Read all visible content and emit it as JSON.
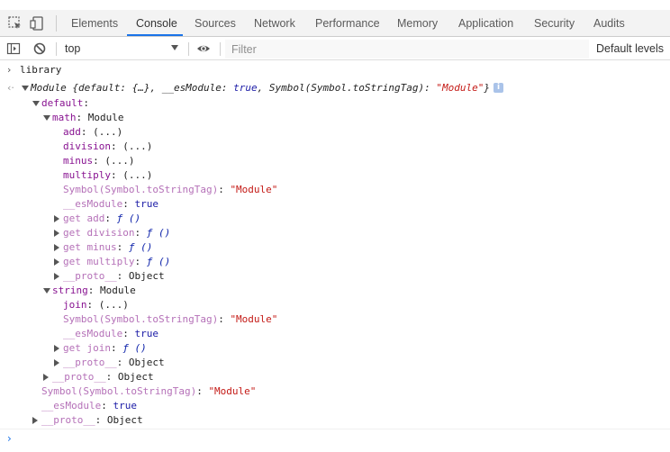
{
  "tabs": [
    {
      "label": "Elements",
      "active": false
    },
    {
      "label": "Console",
      "active": true
    },
    {
      "label": "Sources",
      "active": false
    },
    {
      "label": "Network",
      "active": false
    },
    {
      "label": "Performance",
      "active": false
    },
    {
      "label": "Memory",
      "active": false
    },
    {
      "label": "Application",
      "active": false
    },
    {
      "label": "Security",
      "active": false
    },
    {
      "label": "Audits",
      "active": false
    }
  ],
  "tab_icons": [
    "inspect-element-icon",
    "device-toolbar-icon"
  ],
  "toolbar": {
    "sidebar_icon": "sidebar-toggle-icon",
    "clear_icon": "clear-console-icon",
    "context": "top",
    "eye_icon": "eye-icon",
    "filter_placeholder": "Filter",
    "filter_value": "",
    "levels": "Default levels"
  },
  "accent_color": "#1a73e8",
  "console": {
    "input": "library",
    "result": {
      "head": "Module {default: {…}, __esModule: ",
      "esmodule_value": "true",
      "tag_text": ", Symbol(Symbol.toStringTag): ",
      "tag_value": "\"Module\"",
      "tail": "}",
      "info": "i"
    },
    "lines": [
      {
        "indent": 0,
        "expander": "down",
        "key": "default",
        "dim": false,
        "parts": []
      },
      {
        "indent": 1,
        "expander": "down",
        "key": "math",
        "dim": false,
        "parts": [
          {
            "text": "Module",
            "cls": ""
          }
        ]
      },
      {
        "indent": 2,
        "expander": "none",
        "key": "add",
        "dim": false,
        "parts": [
          {
            "text": "(...)",
            "cls": ""
          }
        ]
      },
      {
        "indent": 2,
        "expander": "none",
        "key": "division",
        "dim": false,
        "parts": [
          {
            "text": "(...)",
            "cls": ""
          }
        ]
      },
      {
        "indent": 2,
        "expander": "none",
        "key": "minus",
        "dim": false,
        "parts": [
          {
            "text": "(...)",
            "cls": ""
          }
        ]
      },
      {
        "indent": 2,
        "expander": "none",
        "key": "multiply",
        "dim": false,
        "parts": [
          {
            "text": "(...)",
            "cls": ""
          }
        ]
      },
      {
        "indent": 2,
        "expander": "none",
        "key": "Symbol(Symbol.toStringTag)",
        "dim": true,
        "parts": [
          {
            "text": "\"Module\"",
            "cls": "s"
          }
        ]
      },
      {
        "indent": 2,
        "expander": "none",
        "key": "__esModule",
        "dim": true,
        "parts": [
          {
            "text": "true",
            "cls": "bool"
          }
        ]
      },
      {
        "indent": 2,
        "expander": "right",
        "key": "get add",
        "dim": true,
        "parts": [
          {
            "text": "ƒ ()",
            "cls": "fn"
          }
        ]
      },
      {
        "indent": 2,
        "expander": "right",
        "key": "get division",
        "dim": true,
        "parts": [
          {
            "text": "ƒ ()",
            "cls": "fn"
          }
        ]
      },
      {
        "indent": 2,
        "expander": "right",
        "key": "get minus",
        "dim": true,
        "parts": [
          {
            "text": "ƒ ()",
            "cls": "fn"
          }
        ]
      },
      {
        "indent": 2,
        "expander": "right",
        "key": "get multiply",
        "dim": true,
        "parts": [
          {
            "text": "ƒ ()",
            "cls": "fn"
          }
        ]
      },
      {
        "indent": 2,
        "expander": "right",
        "key": "__proto__",
        "dim": true,
        "parts": [
          {
            "text": "Object",
            "cls": ""
          }
        ]
      },
      {
        "indent": 1,
        "expander": "down",
        "key": "string",
        "dim": false,
        "parts": [
          {
            "text": "Module",
            "cls": ""
          }
        ]
      },
      {
        "indent": 2,
        "expander": "none",
        "key": "join",
        "dim": false,
        "parts": [
          {
            "text": "(...)",
            "cls": ""
          }
        ]
      },
      {
        "indent": 2,
        "expander": "none",
        "key": "Symbol(Symbol.toStringTag)",
        "dim": true,
        "parts": [
          {
            "text": "\"Module\"",
            "cls": "s"
          }
        ]
      },
      {
        "indent": 2,
        "expander": "none",
        "key": "__esModule",
        "dim": true,
        "parts": [
          {
            "text": "true",
            "cls": "bool"
          }
        ]
      },
      {
        "indent": 2,
        "expander": "right",
        "key": "get join",
        "dim": true,
        "parts": [
          {
            "text": "ƒ ()",
            "cls": "fn"
          }
        ]
      },
      {
        "indent": 2,
        "expander": "right",
        "key": "__proto__",
        "dim": true,
        "parts": [
          {
            "text": "Object",
            "cls": ""
          }
        ]
      },
      {
        "indent": 1,
        "expander": "right",
        "key": "__proto__",
        "dim": true,
        "parts": [
          {
            "text": "Object",
            "cls": ""
          }
        ]
      },
      {
        "indent": 0,
        "expander": "none",
        "key": "Symbol(Symbol.toStringTag)",
        "dim": true,
        "parts": [
          {
            "text": "\"Module\"",
            "cls": "s"
          }
        ]
      },
      {
        "indent": 0,
        "expander": "none",
        "key": "__esModule",
        "dim": true,
        "parts": [
          {
            "text": "true",
            "cls": "bool"
          }
        ]
      },
      {
        "indent": 0,
        "expander": "right",
        "key": "__proto__",
        "dim": true,
        "parts": [
          {
            "text": "Object",
            "cls": ""
          }
        ]
      }
    ]
  }
}
